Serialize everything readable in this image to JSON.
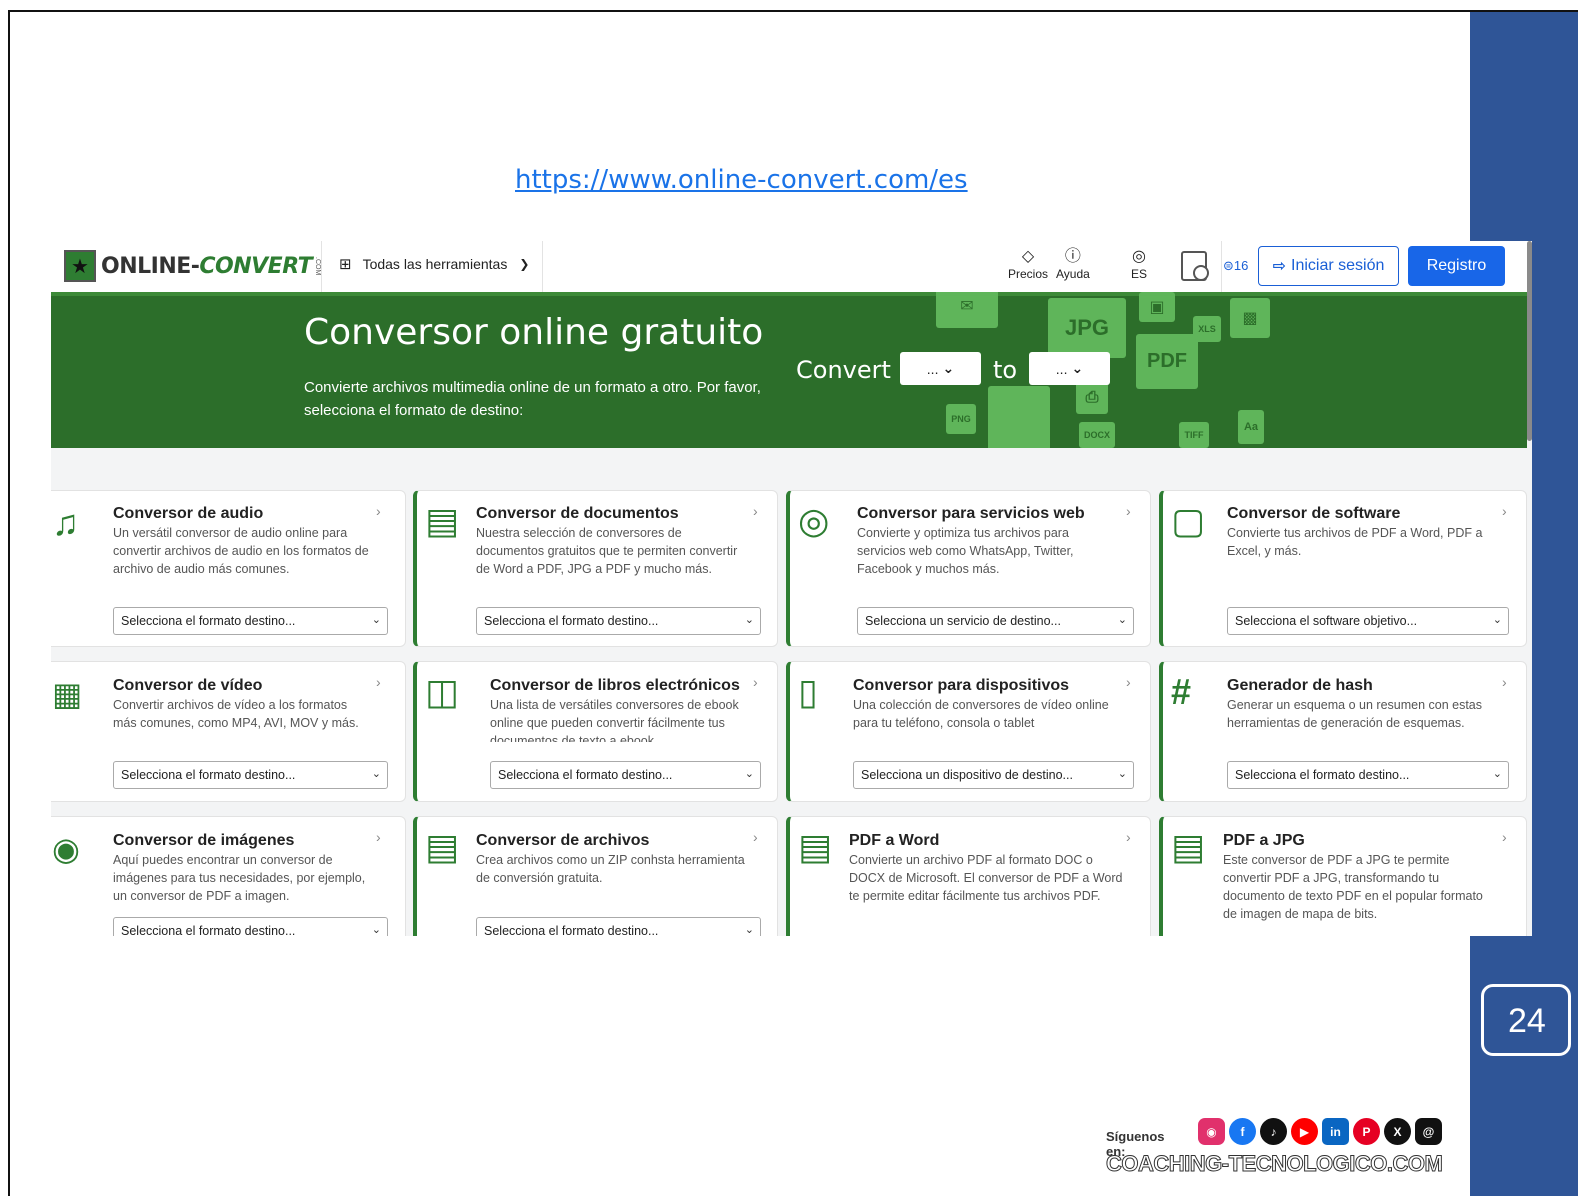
{
  "slide": {
    "url": "https://www.online-convert.com/es",
    "page_number": "24",
    "follow_label": "Síguenos en:",
    "brand": "COACHING-TECNOLOGICO.COM",
    "colors": {
      "side_bar": "#2f5597",
      "link": "#1a73e8"
    },
    "social_icons": [
      "instagram-icon",
      "facebook-icon",
      "tiktok-icon",
      "youtube-icon",
      "linkedin-icon",
      "pinterest-icon",
      "x-icon",
      "threads-icon"
    ]
  },
  "header": {
    "logo_part1": "ONLINE-",
    "logo_part2": "CONVERT",
    "logo_suffix": ".COM",
    "tools_label": "Todas las herramientas",
    "pricing_label": "Precios",
    "help_label": "Ayuda",
    "language": "ES",
    "credits": "16",
    "login_label": "Iniciar sesión",
    "register_label": "Registro",
    "colors": {
      "brand_green": "#2e7d32",
      "primary_blue": "#1866e8"
    }
  },
  "hero": {
    "title": "Conversor online gratuito",
    "subtitle": "Convierte archivos multimedia online de un formato a otro. Por favor, selecciona el formato de destino:",
    "convert_label": "Convert",
    "to_label": "to",
    "from_value": "...",
    "to_value": "...",
    "deco_labels": [
      "JPG",
      "PDF",
      "XLS",
      "PNG",
      "DOCX",
      "TIFF",
      "Aa"
    ],
    "colors": {
      "background": "#2c6e2a"
    }
  },
  "cards": [
    {
      "title": "Conversor de audio",
      "desc": "Un versátil conversor de audio online para convertir archivos de audio en los formatos de archivo de audio más comunes.",
      "select": "Selecciona el formato destino...",
      "icon": "music-note-icon"
    },
    {
      "title": "Conversor de documentos",
      "desc": "Nuestra selección de conversores de documentos gratuitos que te permiten convertir de Word a PDF, JPG a PDF y mucho más.",
      "select": "Selecciona el formato destino...",
      "icon": "document-icon"
    },
    {
      "title": "Conversor para servicios web",
      "desc": "Convierte y optimiza tus archivos para servicios web como WhatsApp, Twitter, Facebook y muchos más.",
      "select": "Selecciona un servicio de destino...",
      "icon": "globe-icon"
    },
    {
      "title": "Conversor de software",
      "desc": "Convierte tus archivos de PDF a Word, PDF a Excel, y más.",
      "select": "Selecciona el software objetivo...",
      "icon": "monitor-icon"
    },
    {
      "title": "Conversor de vídeo",
      "desc": "Convertir archivos de vídeo a los formatos más comunes, como MP4, AVI, MOV y más.",
      "select": "Selecciona el formato destino...",
      "icon": "film-icon"
    },
    {
      "title": "Conversor de libros electrónicos",
      "desc": "Una lista de versátiles conversores de ebook online que pueden convertir fácilmente tus documentos de texto a ebook.",
      "select": "Selecciona el formato destino...",
      "icon": "books-icon"
    },
    {
      "title": "Conversor para dispositivos",
      "desc": "Una colección de conversores de vídeo online para tu teléfono, consola o tablet",
      "select": "Selecciona un dispositivo de destino...",
      "icon": "tablet-icon"
    },
    {
      "title": "Generador de hash",
      "desc": "Generar un esquema o un resumen con estas herramientas de generación de esquemas.",
      "select": "Selecciona el formato destino...",
      "icon": "hash-icon"
    },
    {
      "title": "Conversor de imágenes",
      "desc": "Aquí puedes encontrar un conversor de imágenes para tus necesidades, por ejemplo, un conversor de PDF a imagen.",
      "select": "Selecciona el formato destino...",
      "icon": "camera-icon"
    },
    {
      "title": "Conversor de archivos",
      "desc": "Crea archivos como un ZIP conhsta herramienta de conversión gratuita.",
      "select": "Selecciona el formato destino...",
      "icon": "zip-file-icon"
    },
    {
      "title": "PDF a Word",
      "desc": "Convierte un archivo PDF al formato DOC o DOCX de Microsoft. El conversor de PDF a Word te permite editar fácilmente tus archivos PDF.",
      "icon": "word-file-icon"
    },
    {
      "title": "PDF a JPG",
      "desc": "Este conversor de PDF a JPG te permite convertir PDF a JPG, transformando tu documento de texto PDF en el popular formato de imagen de mapa de bits.",
      "icon": "image-file-icon"
    }
  ]
}
